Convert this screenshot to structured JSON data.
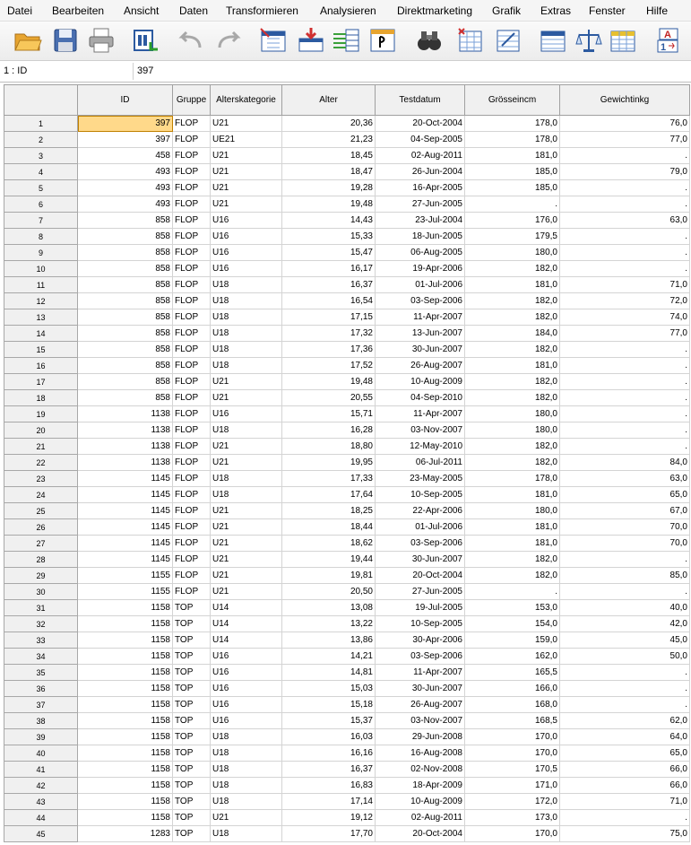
{
  "menu": [
    "Datei",
    "Bearbeiten",
    "Ansicht",
    "Daten",
    "Transformieren",
    "Analysieren",
    "Direktmarketing",
    "Grafik",
    "Extras",
    "Fenster",
    "Hilfe"
  ],
  "toolbar_icons": [
    "open-folder-icon",
    "save-icon",
    "print-icon",
    "dialog-recall-icon",
    "undo-icon",
    "redo-icon",
    "goto-case-icon",
    "goto-variable-icon",
    "variables-icon",
    "run-descriptives-icon",
    "find-icon",
    "insert-cases-icon",
    "insert-variable-icon",
    "split-file-icon",
    "weight-cases-icon",
    "select-cases-icon",
    "value-labels-icon"
  ],
  "cell_ref": "1 : ID",
  "cell_value": "397",
  "columns": [
    "ID",
    "Gruppe",
    "Alterskategorie",
    "Alter",
    "Testdatum",
    "Grösseincm",
    "Gewichtinkg"
  ],
  "rows": [
    [
      "397",
      "FLOP",
      "U21",
      "20,36",
      "20-Oct-2004",
      "178,0",
      "76,0"
    ],
    [
      "397",
      "FLOP",
      "UE21",
      "21,23",
      "04-Sep-2005",
      "178,0",
      "77,0"
    ],
    [
      "458",
      "FLOP",
      "U21",
      "18,45",
      "02-Aug-2011",
      "181,0",
      "."
    ],
    [
      "493",
      "FLOP",
      "U21",
      "18,47",
      "26-Jun-2004",
      "185,0",
      "79,0"
    ],
    [
      "493",
      "FLOP",
      "U21",
      "19,28",
      "16-Apr-2005",
      "185,0",
      "."
    ],
    [
      "493",
      "FLOP",
      "U21",
      "19,48",
      "27-Jun-2005",
      ".",
      "."
    ],
    [
      "858",
      "FLOP",
      "U16",
      "14,43",
      "23-Jul-2004",
      "176,0",
      "63,0"
    ],
    [
      "858",
      "FLOP",
      "U16",
      "15,33",
      "18-Jun-2005",
      "179,5",
      "."
    ],
    [
      "858",
      "FLOP",
      "U16",
      "15,47",
      "06-Aug-2005",
      "180,0",
      "."
    ],
    [
      "858",
      "FLOP",
      "U16",
      "16,17",
      "19-Apr-2006",
      "182,0",
      "."
    ],
    [
      "858",
      "FLOP",
      "U18",
      "16,37",
      "01-Jul-2006",
      "181,0",
      "71,0"
    ],
    [
      "858",
      "FLOP",
      "U18",
      "16,54",
      "03-Sep-2006",
      "182,0",
      "72,0"
    ],
    [
      "858",
      "FLOP",
      "U18",
      "17,15",
      "11-Apr-2007",
      "182,0",
      "74,0"
    ],
    [
      "858",
      "FLOP",
      "U18",
      "17,32",
      "13-Jun-2007",
      "184,0",
      "77,0"
    ],
    [
      "858",
      "FLOP",
      "U18",
      "17,36",
      "30-Jun-2007",
      "182,0",
      "."
    ],
    [
      "858",
      "FLOP",
      "U18",
      "17,52",
      "26-Aug-2007",
      "181,0",
      "."
    ],
    [
      "858",
      "FLOP",
      "U21",
      "19,48",
      "10-Aug-2009",
      "182,0",
      "."
    ],
    [
      "858",
      "FLOP",
      "U21",
      "20,55",
      "04-Sep-2010",
      "182,0",
      "."
    ],
    [
      "1138",
      "FLOP",
      "U16",
      "15,71",
      "11-Apr-2007",
      "180,0",
      "."
    ],
    [
      "1138",
      "FLOP",
      "U18",
      "16,28",
      "03-Nov-2007",
      "180,0",
      "."
    ],
    [
      "1138",
      "FLOP",
      "U21",
      "18,80",
      "12-May-2010",
      "182,0",
      "."
    ],
    [
      "1138",
      "FLOP",
      "U21",
      "19,95",
      "06-Jul-2011",
      "182,0",
      "84,0"
    ],
    [
      "1145",
      "FLOP",
      "U18",
      "17,33",
      "23-May-2005",
      "178,0",
      "63,0"
    ],
    [
      "1145",
      "FLOP",
      "U18",
      "17,64",
      "10-Sep-2005",
      "181,0",
      "65,0"
    ],
    [
      "1145",
      "FLOP",
      "U21",
      "18,25",
      "22-Apr-2006",
      "180,0",
      "67,0"
    ],
    [
      "1145",
      "FLOP",
      "U21",
      "18,44",
      "01-Jul-2006",
      "181,0",
      "70,0"
    ],
    [
      "1145",
      "FLOP",
      "U21",
      "18,62",
      "03-Sep-2006",
      "181,0",
      "70,0"
    ],
    [
      "1145",
      "FLOP",
      "U21",
      "19,44",
      "30-Jun-2007",
      "182,0",
      "."
    ],
    [
      "1155",
      "FLOP",
      "U21",
      "19,81",
      "20-Oct-2004",
      "182,0",
      "85,0"
    ],
    [
      "1155",
      "FLOP",
      "U21",
      "20,50",
      "27-Jun-2005",
      ".",
      "."
    ],
    [
      "1158",
      "TOP",
      "U14",
      "13,08",
      "19-Jul-2005",
      "153,0",
      "40,0"
    ],
    [
      "1158",
      "TOP",
      "U14",
      "13,22",
      "10-Sep-2005",
      "154,0",
      "42,0"
    ],
    [
      "1158",
      "TOP",
      "U14",
      "13,86",
      "30-Apr-2006",
      "159,0",
      "45,0"
    ],
    [
      "1158",
      "TOP",
      "U16",
      "14,21",
      "03-Sep-2006",
      "162,0",
      "50,0"
    ],
    [
      "1158",
      "TOP",
      "U16",
      "14,81",
      "11-Apr-2007",
      "165,5",
      "."
    ],
    [
      "1158",
      "TOP",
      "U16",
      "15,03",
      "30-Jun-2007",
      "166,0",
      "."
    ],
    [
      "1158",
      "TOP",
      "U16",
      "15,18",
      "26-Aug-2007",
      "168,0",
      "."
    ],
    [
      "1158",
      "TOP",
      "U16",
      "15,37",
      "03-Nov-2007",
      "168,5",
      "62,0"
    ],
    [
      "1158",
      "TOP",
      "U18",
      "16,03",
      "29-Jun-2008",
      "170,0",
      "64,0"
    ],
    [
      "1158",
      "TOP",
      "U18",
      "16,16",
      "16-Aug-2008",
      "170,0",
      "65,0"
    ],
    [
      "1158",
      "TOP",
      "U18",
      "16,37",
      "02-Nov-2008",
      "170,5",
      "66,0"
    ],
    [
      "1158",
      "TOP",
      "U18",
      "16,83",
      "18-Apr-2009",
      "171,0",
      "66,0"
    ],
    [
      "1158",
      "TOP",
      "U18",
      "17,14",
      "10-Aug-2009",
      "172,0",
      "71,0"
    ],
    [
      "1158",
      "TOP",
      "U21",
      "19,12",
      "02-Aug-2011",
      "173,0",
      "."
    ],
    [
      "1283",
      "TOP",
      "U18",
      "17,70",
      "20-Oct-2004",
      "170,0",
      "75,0"
    ]
  ]
}
